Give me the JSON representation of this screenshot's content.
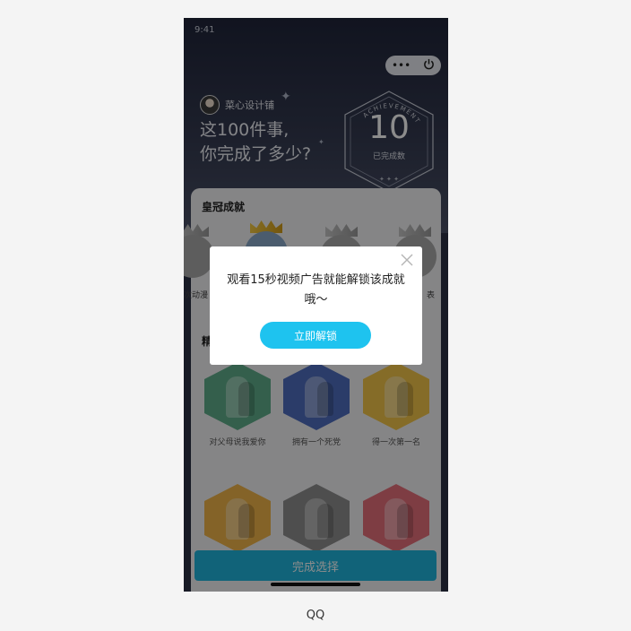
{
  "status_bar": {
    "time": "9:41"
  },
  "capsule": {
    "more_icon": "more-dots-icon",
    "power_icon": "power-icon"
  },
  "author": {
    "name": "菜心设计铺"
  },
  "headline": {
    "line1": "这100件事,",
    "line2": "你完成了多少?"
  },
  "badge": {
    "arc_text": "ACHIEVEMENT",
    "count": "10",
    "label": "已完成数"
  },
  "crown_section": {
    "title": "皇冠成就",
    "items": [
      {
        "label": "次动漫",
        "state": "locked"
      },
      {
        "label": "",
        "state": "unlocked"
      },
      {
        "label": "",
        "state": "locked"
      },
      {
        "label": "表",
        "state": "locked"
      }
    ]
  },
  "featured_section": {
    "title": "精"
  },
  "grid_items": [
    {
      "label": "对父母说我爱你",
      "color": "#5fae8a"
    },
    {
      "label": "拥有一个死党",
      "color": "#4f6dbf"
    },
    {
      "label": "得一次第一名",
      "color": "#f2c54a"
    },
    {
      "label": "",
      "color": "#f0b449"
    },
    {
      "label": "",
      "color": "#8f8f8f"
    },
    {
      "label": "",
      "color": "#e6707b"
    }
  ],
  "complete_button": {
    "label": "完成选择"
  },
  "modal": {
    "message": "观看15秒视频广告就能解锁该成就哦～",
    "button": "立即解锁",
    "close_icon": "close-icon"
  },
  "caption": "QQ",
  "colors": {
    "accent": "#1ec3ef",
    "hero_bg": "#2d3246"
  }
}
